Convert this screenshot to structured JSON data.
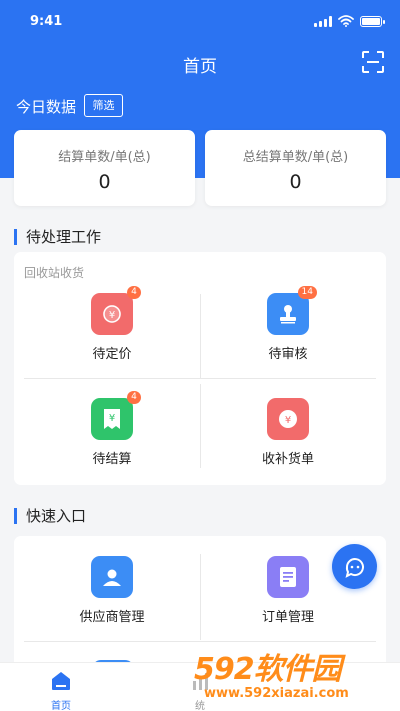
{
  "status_bar": {
    "time": "9:41"
  },
  "header": {
    "title": "首页"
  },
  "today": {
    "label": "今日数据",
    "filter_label": "筛选"
  },
  "stats": [
    {
      "label": "结算单数/单(总)",
      "value": "0"
    },
    {
      "label": "总结算单数/单(总)",
      "value": "0"
    }
  ],
  "pending": {
    "section_title": "待处理工作",
    "subtitle": "回收站收货",
    "items": [
      {
        "label": "待定价",
        "badge": "4",
        "icon": "yen-coin-icon",
        "color": "#f26b6b"
      },
      {
        "label": "待审核",
        "badge": "14",
        "icon": "stamp-icon",
        "color": "#3c8df5"
      },
      {
        "label": "待结算",
        "badge": "4",
        "icon": "yen-receipt-icon",
        "color": "#2fc46b"
      },
      {
        "label": "收补货单",
        "badge": "",
        "icon": "yen-circle-icon",
        "color": "#f26b6b"
      }
    ]
  },
  "quick": {
    "section_title": "快速入口",
    "items": [
      {
        "label": "供应商管理",
        "icon": "supplier-person-icon",
        "color": "#3c8df5"
      },
      {
        "label": "订单管理",
        "icon": "order-document-icon",
        "color": "#8a7ef5"
      }
    ]
  },
  "tabbar": {
    "home_label": "首页",
    "second_label": "统"
  },
  "watermark": {
    "big": "592软件园",
    "small": "www.592xiazai.com"
  },
  "colors": {
    "primary": "#2b73f2",
    "badge": "#ff7043"
  }
}
